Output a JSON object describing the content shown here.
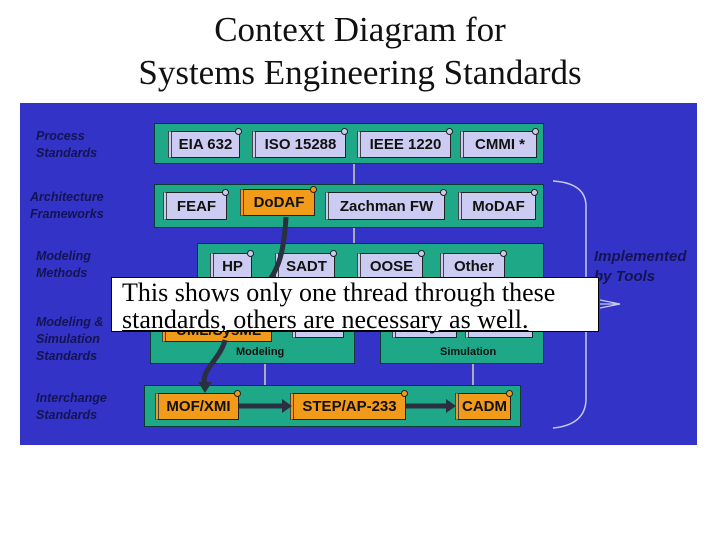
{
  "title": {
    "line1": "Context Diagram for",
    "line2": "Systems Engineering Standards"
  },
  "rows": {
    "process": {
      "label1": "Process",
      "label2": "Standards",
      "items": [
        "EIA 632",
        "ISO 15288",
        "IEEE 1220",
        "CMMI *"
      ]
    },
    "architecture": {
      "label1": "Architecture",
      "label2": "Frameworks",
      "items": [
        "FEAF",
        "DoDAF",
        "Zachman FW",
        "MoDAF"
      ]
    },
    "methods": {
      "label1": "Modeling",
      "label2": "Methods",
      "items": [
        "HP",
        "SADT",
        "OOSE",
        "Other"
      ]
    },
    "modsim": {
      "label1": "Modeling &",
      "label2": "Simulation",
      "label3": "Standards",
      "modeling_label": "Modeling",
      "simulation_label": "Simulation",
      "modeling_items": [
        "UML/SysML"
      ]
    },
    "interchange": {
      "label1": "Interchange",
      "label2": "Standards",
      "items": [
        "MOF/XMI",
        "STEP/AP-233",
        "CADM"
      ]
    }
  },
  "highlighted": [
    "DoDAF",
    "UML/SysML",
    "MOF/XMI",
    "STEP/AP-233",
    "CADM"
  ],
  "tools": {
    "line1": "Implemented",
    "line2": "by Tools"
  },
  "callout": {
    "line1": "This shows only one thread through these",
    "line2": "standards, others are necessary as well."
  },
  "colors": {
    "background": "#3333c8",
    "group": "#1ea888",
    "standard": "#ccccf2",
    "highlight": "#f29a1a"
  }
}
